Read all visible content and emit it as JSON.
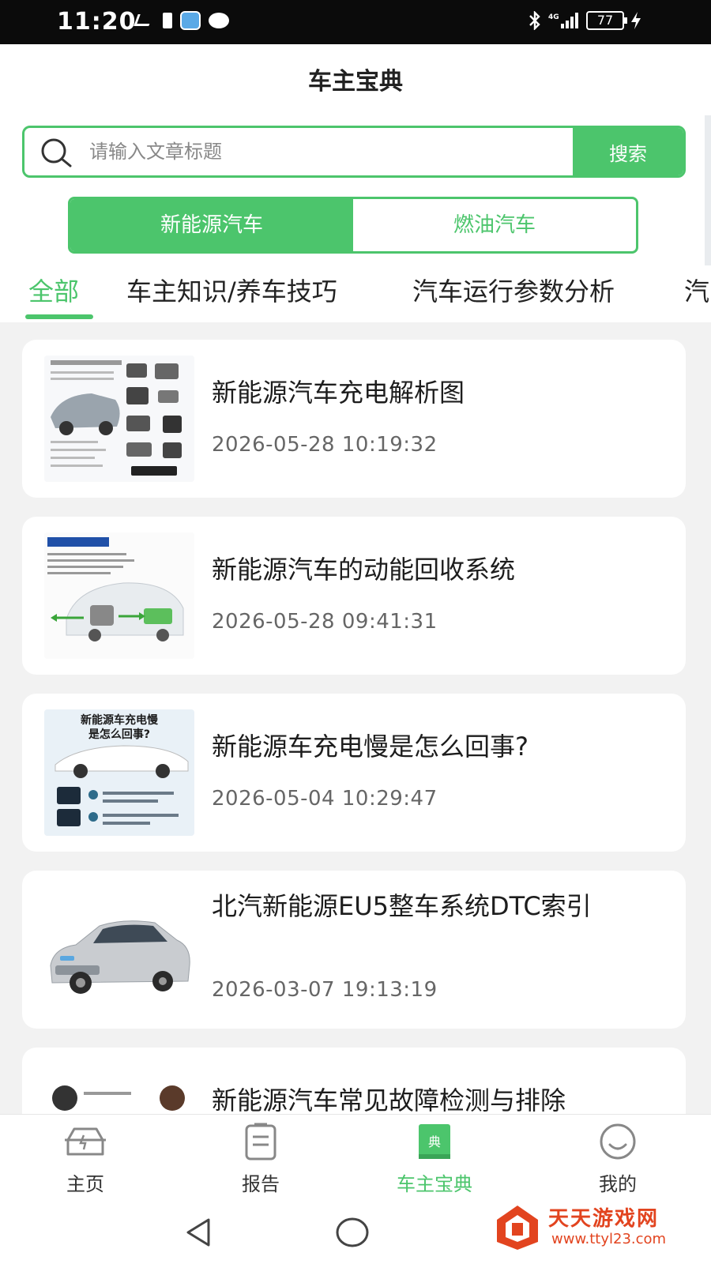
{
  "status_bar": {
    "time": "11:20",
    "battery": "77"
  },
  "header": {
    "title": "车主宝典"
  },
  "search": {
    "placeholder": "请输入文章标题",
    "button_label": "搜索"
  },
  "segment": {
    "options": [
      "新能源汽车",
      "燃油汽车"
    ],
    "selected": "新能源汽车"
  },
  "category_tabs": {
    "items": [
      "全部",
      "车主知识/养车技巧",
      "汽车运行参数分析",
      "汽"
    ],
    "selected": "全部"
  },
  "articles": [
    {
      "title": "新能源汽车充电解析图",
      "date": "2026-05-28 10:19:32",
      "thumb_icon": "ev-charging-diagram-image"
    },
    {
      "title": "新能源汽车的动能回收系统",
      "date": "2026-05-28 09:41:31",
      "thumb_icon": "energy-recovery-diagram-image"
    },
    {
      "title": "新能源车充电慢是怎么回事?",
      "date": "2026-05-04 10:29:47",
      "thumb_icon": "slow-charging-infographic-image",
      "thumb_text_1": "新能源车充电慢",
      "thumb_text_2": "是怎么回事?"
    },
    {
      "title": "北汽新能源EU5整车系统DTC索引",
      "date": "2026-03-07 19:13:19",
      "thumb_icon": "silver-sedan-image"
    },
    {
      "title": "新能源汽车常见故障检测与排除",
      "thumb_icon": "mechanics-image"
    }
  ],
  "tab_bar": {
    "items": [
      {
        "label": "主页",
        "icon": "home-car-icon"
      },
      {
        "label": "报告",
        "icon": "report-icon"
      },
      {
        "label": "车主宝典",
        "icon": "handbook-icon",
        "icon_text": "典"
      },
      {
        "label": "我的",
        "icon": "profile-icon"
      }
    ],
    "selected": "车主宝典"
  },
  "watermark": {
    "name": "天天游戏网",
    "url": "www.ttyl23.com"
  },
  "colors": {
    "accent": "#4cc56c",
    "background": "#f2f2f2",
    "watermark": "#e2441f"
  }
}
